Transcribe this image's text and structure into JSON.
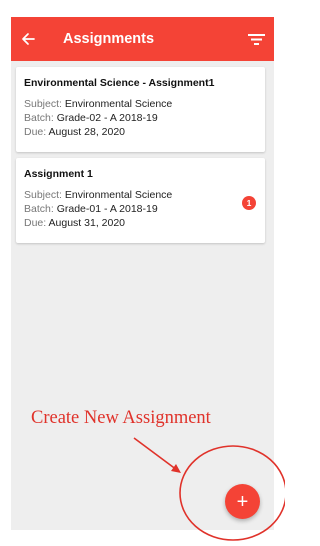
{
  "app_bar": {
    "title": "Assignments",
    "back_icon": "arrow-left-icon",
    "filter_icon": "filter-icon",
    "color": "#f44336"
  },
  "assignments": [
    {
      "title": "Environmental Science - Assignment1",
      "subject_label": "Subject:",
      "subject": "Environmental Science",
      "batch_label": "Batch:",
      "batch": "Grade-02 - A 2018-19",
      "due_label": "Due:",
      "due": "August 28, 2020"
    },
    {
      "title": "Assignment 1",
      "subject_label": "Subject:",
      "subject": "Environmental Science",
      "batch_label": "Batch:",
      "batch": "Grade-01 - A 2018-19",
      "due_label": "Due:",
      "due": "August 31, 2020",
      "badge": "1"
    }
  ],
  "annotation": {
    "text": "Create New Assignment",
    "color": "#e0322a"
  },
  "fab": {
    "label": "+",
    "icon": "plus-icon",
    "color": "#f44336"
  }
}
